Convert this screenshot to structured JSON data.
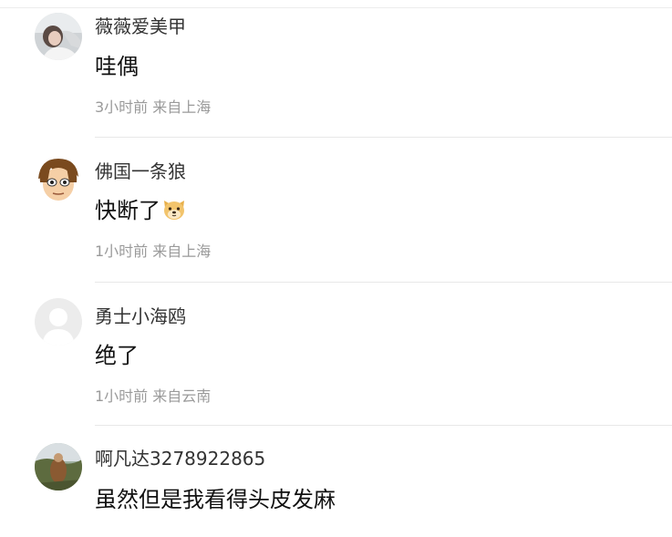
{
  "comments": [
    {
      "username": "薇薇爱美甲",
      "content": "哇偶",
      "time": "3小时前",
      "location": "来自上海",
      "avatar_icon": "photo-avatar"
    },
    {
      "username": "佛国一条狼",
      "content": "快断了",
      "emoji_icon": "doge-emoji",
      "time": "1小时前",
      "location": "来自上海",
      "avatar_icon": "cartoon-face-avatar"
    },
    {
      "username": "勇士小海鸥",
      "content": "绝了",
      "time": "1小时前",
      "location": "来自云南",
      "avatar_icon": "default-avatar"
    },
    {
      "username": "啊凡达3278922865",
      "content": "虽然但是我看得头皮发麻",
      "avatar_icon": "outdoor-photo-avatar"
    }
  ],
  "colors": {
    "username": "#333333",
    "content": "#111111",
    "meta": "#9a9a9a",
    "divider": "#e8e8e8"
  }
}
